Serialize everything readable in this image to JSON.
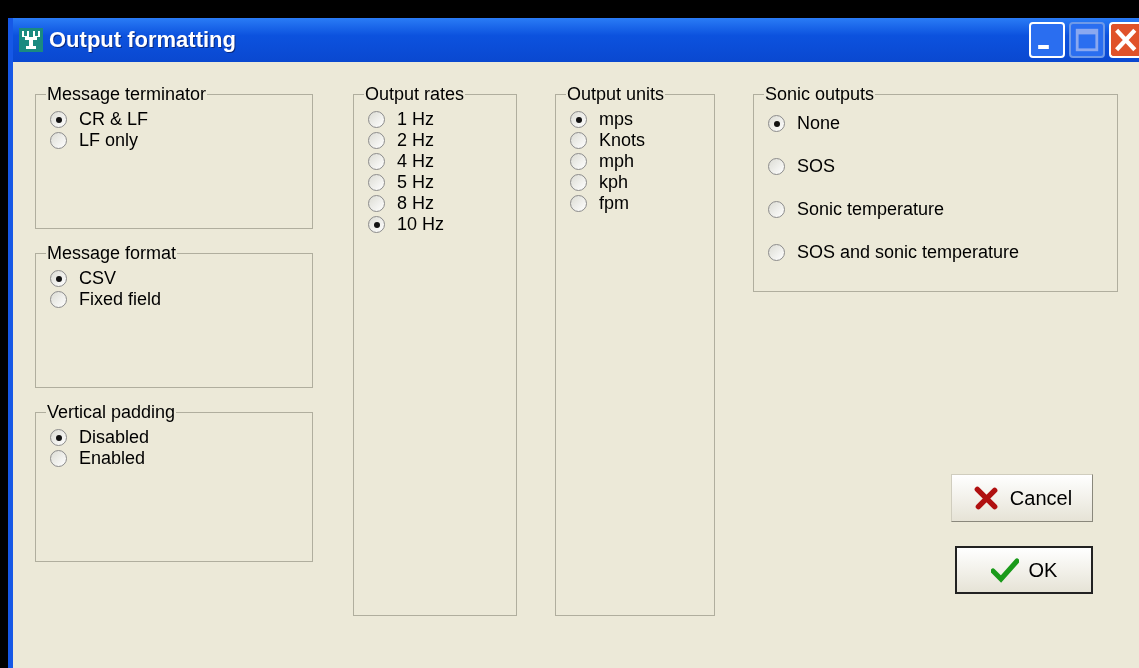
{
  "window": {
    "title": "Output formatting"
  },
  "columns": [
    {
      "groups": [
        {
          "title": "Message terminator",
          "options": [
            {
              "label": "CR & LF",
              "selected": true
            },
            {
              "label": "LF only",
              "selected": false
            }
          ]
        },
        {
          "title": "Message format",
          "options": [
            {
              "label": "CSV",
              "selected": true
            },
            {
              "label": "Fixed field",
              "selected": false
            }
          ]
        },
        {
          "title": "Vertical padding",
          "options": [
            {
              "label": "Disabled",
              "selected": true
            },
            {
              "label": "Enabled",
              "selected": false
            }
          ]
        }
      ]
    },
    {
      "groups": [
        {
          "title": "Output rates",
          "options": [
            {
              "label": "1 Hz",
              "selected": false
            },
            {
              "label": "2 Hz",
              "selected": false
            },
            {
              "label": "4 Hz",
              "selected": false
            },
            {
              "label": "5 Hz",
              "selected": false
            },
            {
              "label": "8 Hz",
              "selected": false
            },
            {
              "label": "10 Hz",
              "selected": true
            }
          ]
        }
      ]
    },
    {
      "groups": [
        {
          "title": "Output units",
          "options": [
            {
              "label": "mps",
              "selected": true
            },
            {
              "label": "Knots",
              "selected": false
            },
            {
              "label": "mph",
              "selected": false
            },
            {
              "label": "kph",
              "selected": false
            },
            {
              "label": "fpm",
              "selected": false
            }
          ]
        }
      ]
    },
    {
      "groups": [
        {
          "title": "Sonic outputs",
          "options": [
            {
              "label": "None",
              "selected": true
            },
            {
              "label": "SOS",
              "selected": false
            },
            {
              "label": "Sonic temperature",
              "selected": false
            },
            {
              "label": "SOS and sonic temperature",
              "selected": false
            }
          ]
        }
      ]
    }
  ],
  "buttons": [
    {
      "kind": "cancel",
      "label": "Cancel",
      "default": false
    },
    {
      "kind": "ok",
      "label": "OK",
      "default": true
    }
  ]
}
